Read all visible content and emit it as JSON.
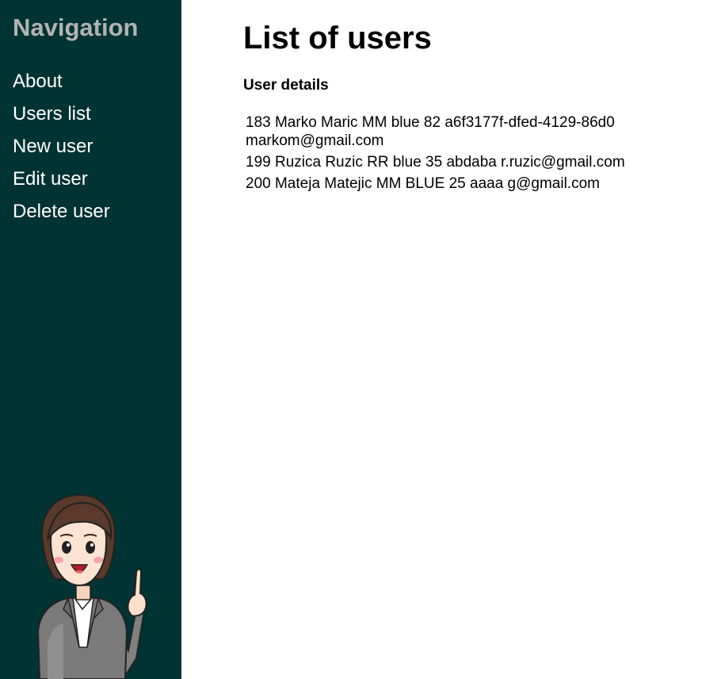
{
  "sidebar": {
    "title": "Navigation",
    "items": [
      {
        "label": "About"
      },
      {
        "label": "Users list"
      },
      {
        "label": "New user"
      },
      {
        "label": "Edit user"
      },
      {
        "label": "Delete user"
      }
    ]
  },
  "main": {
    "title": "List of users",
    "section_title": "User details",
    "users": [
      {
        "text": "183 Marko Maric MM blue 82 a6f3177f-dfed-4129-86d0 markom@gmail.com"
      },
      {
        "text": "199 Ruzica Ruzic RR blue 35 abdaba r.ruzic@gmail.com"
      },
      {
        "text": "200 Mateja Matejic MM BLUE 25 aaaa g@gmail.com"
      }
    ]
  },
  "colors": {
    "sidebar_bg": "#003333",
    "nav_title": "#b3b3b3",
    "nav_link": "#ffffff"
  },
  "icons": {
    "mascot": "cartoon-woman-pointing-illustration"
  }
}
